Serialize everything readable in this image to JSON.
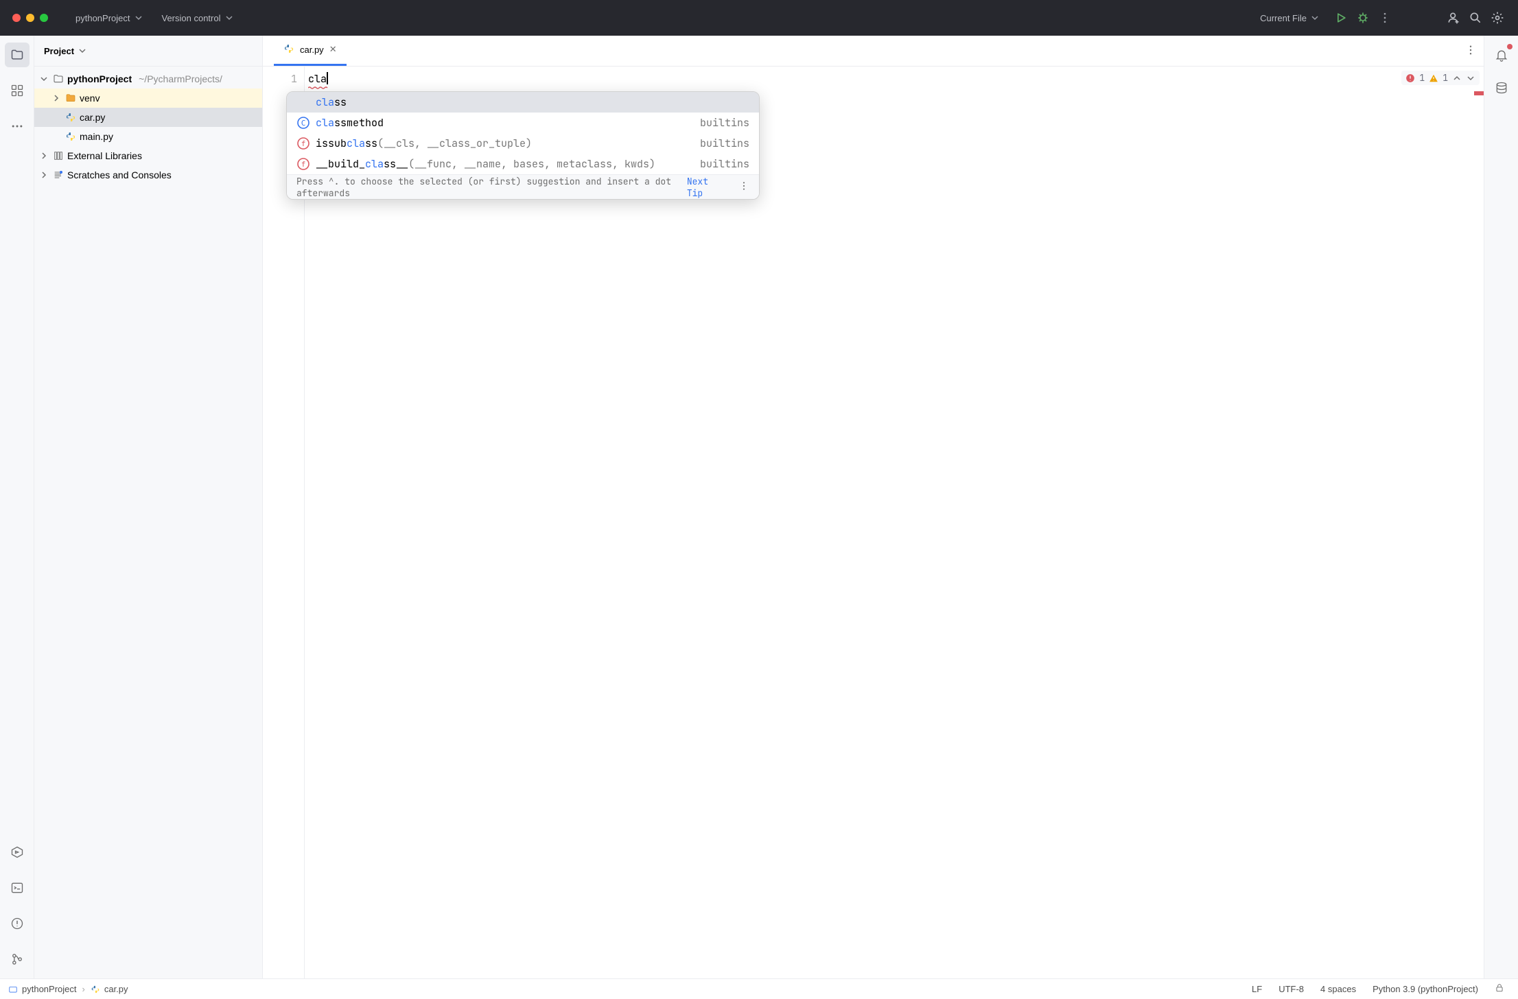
{
  "titlebar": {
    "project_name": "pythonProject",
    "vcs_label": "Version control",
    "run_config": "Current File"
  },
  "project_pane": {
    "title": "Project",
    "root_name": "pythonProject",
    "root_path": "~/PycharmProjects/",
    "venv_label": "venv",
    "car_label": "car.py",
    "main_label": "main.py",
    "ext_lib_label": "External Libraries",
    "scratches_label": "Scratches and Consoles"
  },
  "editor_tab": {
    "file_name": "car.py"
  },
  "editor": {
    "line_number": "1",
    "code_text": "cla"
  },
  "inspections": {
    "error_count": "1",
    "warning_count": "1"
  },
  "completion": {
    "items": [
      {
        "kind": "keyword",
        "icon": "",
        "pre_hl": "",
        "hl": "cla",
        "post_hl": "ss",
        "params": "",
        "tail": ""
      },
      {
        "kind": "class",
        "icon": "C",
        "pre_hl": "",
        "hl": "cla",
        "post_hl": "ssmethod",
        "params": "",
        "tail": "builtins"
      },
      {
        "kind": "func",
        "icon": "f",
        "pre_hl": "issub",
        "hl": "cla",
        "post_hl": "ss",
        "params": "(__cls, __class_or_tuple)",
        "tail": "builtins"
      },
      {
        "kind": "func",
        "icon": "f",
        "pre_hl": "__build_",
        "hl": "cla",
        "post_hl": "ss__",
        "params": "(__func, __name, bases, metaclass, kwds)",
        "tail": "builtins"
      }
    ],
    "hint_text": "Press ^. to choose the selected (or first) suggestion and insert a dot afterwards",
    "next_tip": "Next Tip"
  },
  "breadcrumbs": {
    "project": "pythonProject",
    "file": "car.py"
  },
  "statusbar": {
    "line_sep": "LF",
    "encoding": "UTF-8",
    "indent": "4 spaces",
    "interpreter": "Python 3.9 (pythonProject)"
  }
}
